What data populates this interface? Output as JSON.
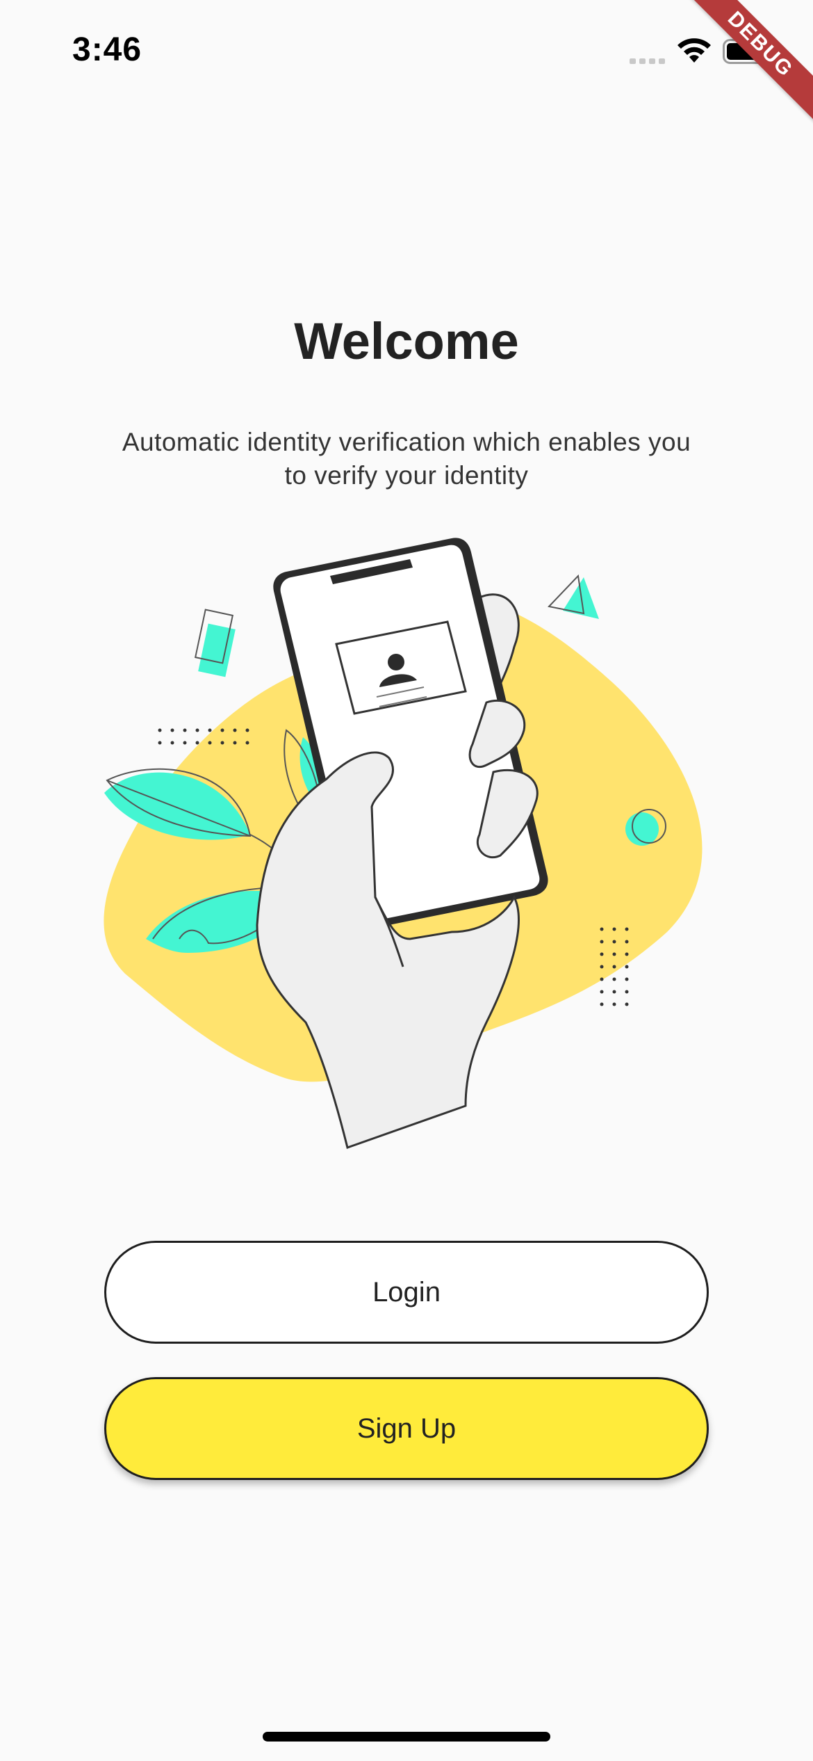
{
  "status_bar": {
    "time": "3:46",
    "icons": [
      "signal-icon",
      "wifi-icon",
      "battery-icon"
    ]
  },
  "debug_banner": {
    "label": "DEBUG",
    "color": "#b53b3b"
  },
  "welcome": {
    "title": "Welcome",
    "subtitle": "Automatic identity verification which enables you to verify your identity"
  },
  "illustration": {
    "subject": "hand-holding-phone-id-card-illustration",
    "colors": {
      "blob": "#ffe36e",
      "accent": "#44f5d2",
      "hand": "#efefef",
      "outline": "#2b2b2b"
    }
  },
  "buttons": {
    "login_label": "Login",
    "signup_label": "Sign Up"
  },
  "colors": {
    "background": "#fafafa",
    "primary": "#ffeb3b",
    "text": "#212121"
  }
}
